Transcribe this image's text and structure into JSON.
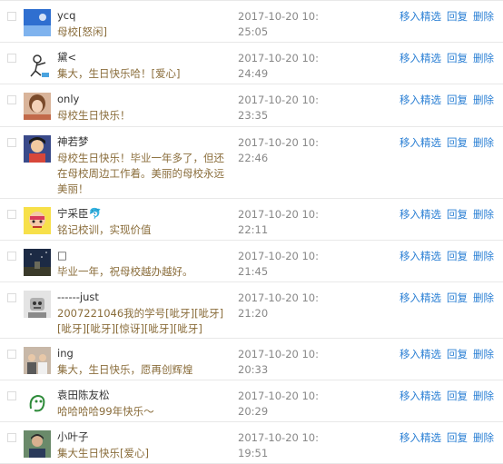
{
  "comments": [
    {
      "name": "ycq",
      "message": "母校[怒闲]",
      "time": "2017-10-20 10:25:05",
      "avatar_icon": "blue-sky-avatar-icon"
    },
    {
      "name": "黛<",
      "message": "集大，生日快乐哈！[爱心]",
      "time": "2017-10-20 10:24:49",
      "avatar_icon": "sketch-figure-avatar-icon"
    },
    {
      "name": "only",
      "message": "母校生日快乐！",
      "time": "2017-10-20 10:23:35",
      "avatar_icon": "girl-portrait-avatar-icon"
    },
    {
      "name": "神若梦",
      "message": "母校生日快乐！毕业一年多了，但还在母校周边工作着。美丽的母校永远美丽！",
      "time": "2017-10-20 10:22:46",
      "avatar_icon": "cartoon-avatar-icon"
    },
    {
      "name": "宁采臣🐬",
      "message": "铭记校训，实现价值",
      "time": "2017-10-20 10:22:11",
      "avatar_icon": "yellow-cartoon-avatar-icon"
    },
    {
      "name": "",
      "message": "毕业一年，祝母校越办越好。",
      "time": "2017-10-20 10:21:45",
      "avatar_icon": "night-sky-avatar-icon"
    },
    {
      "name": "------just",
      "message": "2007221046我的学号[呲牙][呲牙][呲牙][呲牙][惊讶][呲牙][呲牙]",
      "time": "2017-10-20 10:21:20",
      "avatar_icon": "robot-avatar-icon"
    },
    {
      "name": "ing",
      "message": "集大，生日快乐，愿再创辉煌",
      "time": "2017-10-20 10:20:33",
      "avatar_icon": "group-photo-avatar-icon"
    },
    {
      "name": "袁田陈友松",
      "message": "哈哈哈哈99年快乐～",
      "time": "2017-10-20 10:20:29",
      "avatar_icon": "green-doodle-avatar-icon"
    },
    {
      "name": "小叶子",
      "message": "集大生日快乐[爱心]",
      "time": "2017-10-20 10:19:51",
      "avatar_icon": "person-photo-avatar-icon"
    }
  ],
  "actions": {
    "move_featured": "移入精选",
    "reply": "回复",
    "delete": "删除"
  },
  "colors": {
    "link": "#2a7fd4",
    "message": "#8a6d3b",
    "time": "#888888"
  }
}
